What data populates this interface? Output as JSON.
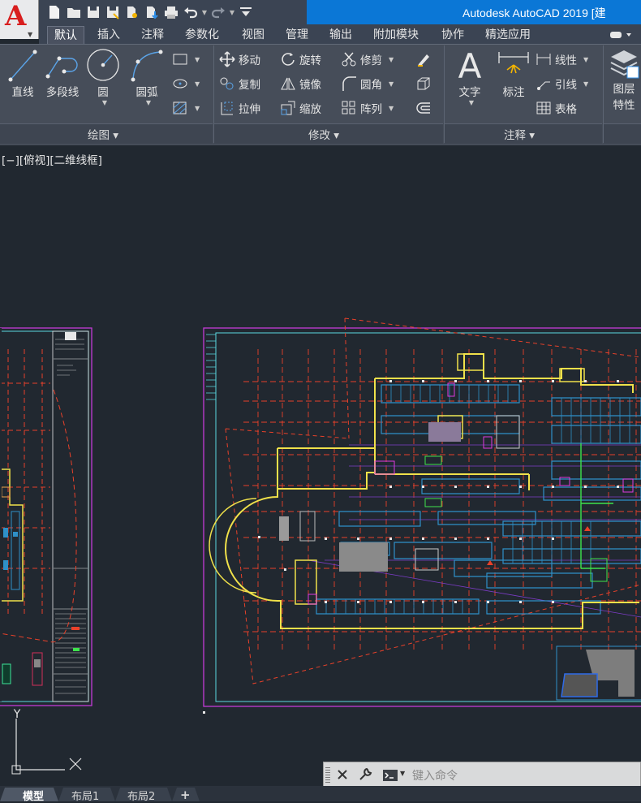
{
  "app": {
    "title": "Autodesk AutoCAD 2019 [建",
    "logo_letter": "A"
  },
  "quick_access": [
    "new-icon",
    "open-icon",
    "save-icon",
    "save-as-icon",
    "cloud-open-icon",
    "cloud-save-icon",
    "plot-icon",
    "undo-icon",
    "redo-icon",
    "customize-icon"
  ],
  "tabs": [
    {
      "label": "默认",
      "active": true
    },
    {
      "label": "插入"
    },
    {
      "label": "注释"
    },
    {
      "label": "参数化"
    },
    {
      "label": "视图"
    },
    {
      "label": "管理"
    },
    {
      "label": "输出"
    },
    {
      "label": "附加模块"
    },
    {
      "label": "协作"
    },
    {
      "label": "精选应用"
    }
  ],
  "ribbon": {
    "draw": {
      "title": "绘图 ▾",
      "line": "直线",
      "polyline": "多段线",
      "circle": "圆",
      "arc": "圆弧"
    },
    "modify": {
      "title": "修改 ▾",
      "move": "移动",
      "rotate": "旋转",
      "trim": "修剪",
      "copy": "复制",
      "mirror": "镜像",
      "fillet": "圆角",
      "stretch": "拉伸",
      "scale": "缩放",
      "array": "阵列"
    },
    "annotation": {
      "title": "注释 ▾",
      "text": "文字",
      "dimension": "标注",
      "linear": "线性",
      "leader": "引线",
      "table": "表格"
    },
    "layers": {
      "label_line1": "图层",
      "label_line2": "特性"
    }
  },
  "viewport": {
    "label": "[−][俯视][二维线框]"
  },
  "command": {
    "placeholder": "键入命令"
  },
  "layout_tabs": {
    "model": "模型",
    "layout1": "布局1",
    "layout2": "布局2"
  },
  "colors": {
    "accent": "#0b77d6",
    "canvas": "#212830",
    "ribbon": "#464d59"
  }
}
